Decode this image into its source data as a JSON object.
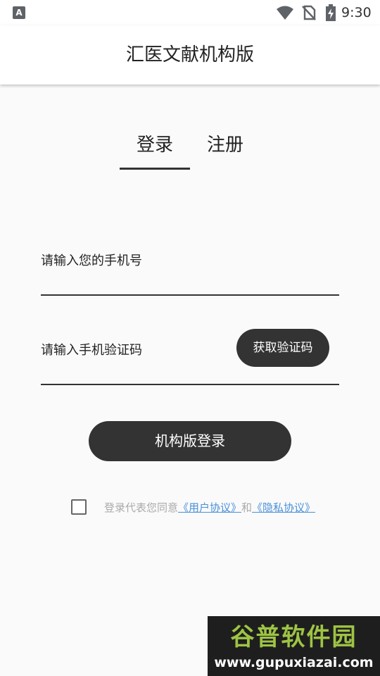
{
  "status_bar": {
    "time": "9:30",
    "notification_icon": "A",
    "icons": [
      "wifi-icon",
      "no-sim-icon",
      "battery-charging-icon"
    ]
  },
  "app_bar": {
    "title": "汇医文献机构版"
  },
  "tabs": {
    "login": "登录",
    "register": "注册",
    "active": "login"
  },
  "form": {
    "phone_placeholder": "请输入您的手机号",
    "code_placeholder": "请输入手机验证码",
    "get_code_label": "获取验证码",
    "submit_label": "机构版登录"
  },
  "agreement": {
    "checked": false,
    "prefix": "登录代表您同意",
    "user_agreement": "《用户协议》",
    "conjunction": "和",
    "privacy_policy": "《隐私协议》"
  },
  "watermark": {
    "title": "谷普软件园",
    "url": "www.gupuxiazai.com"
  },
  "colors": {
    "primary": "#333333",
    "background": "#fafafa",
    "link": "#4a90d9",
    "hint_text": "#aaaaaa"
  }
}
